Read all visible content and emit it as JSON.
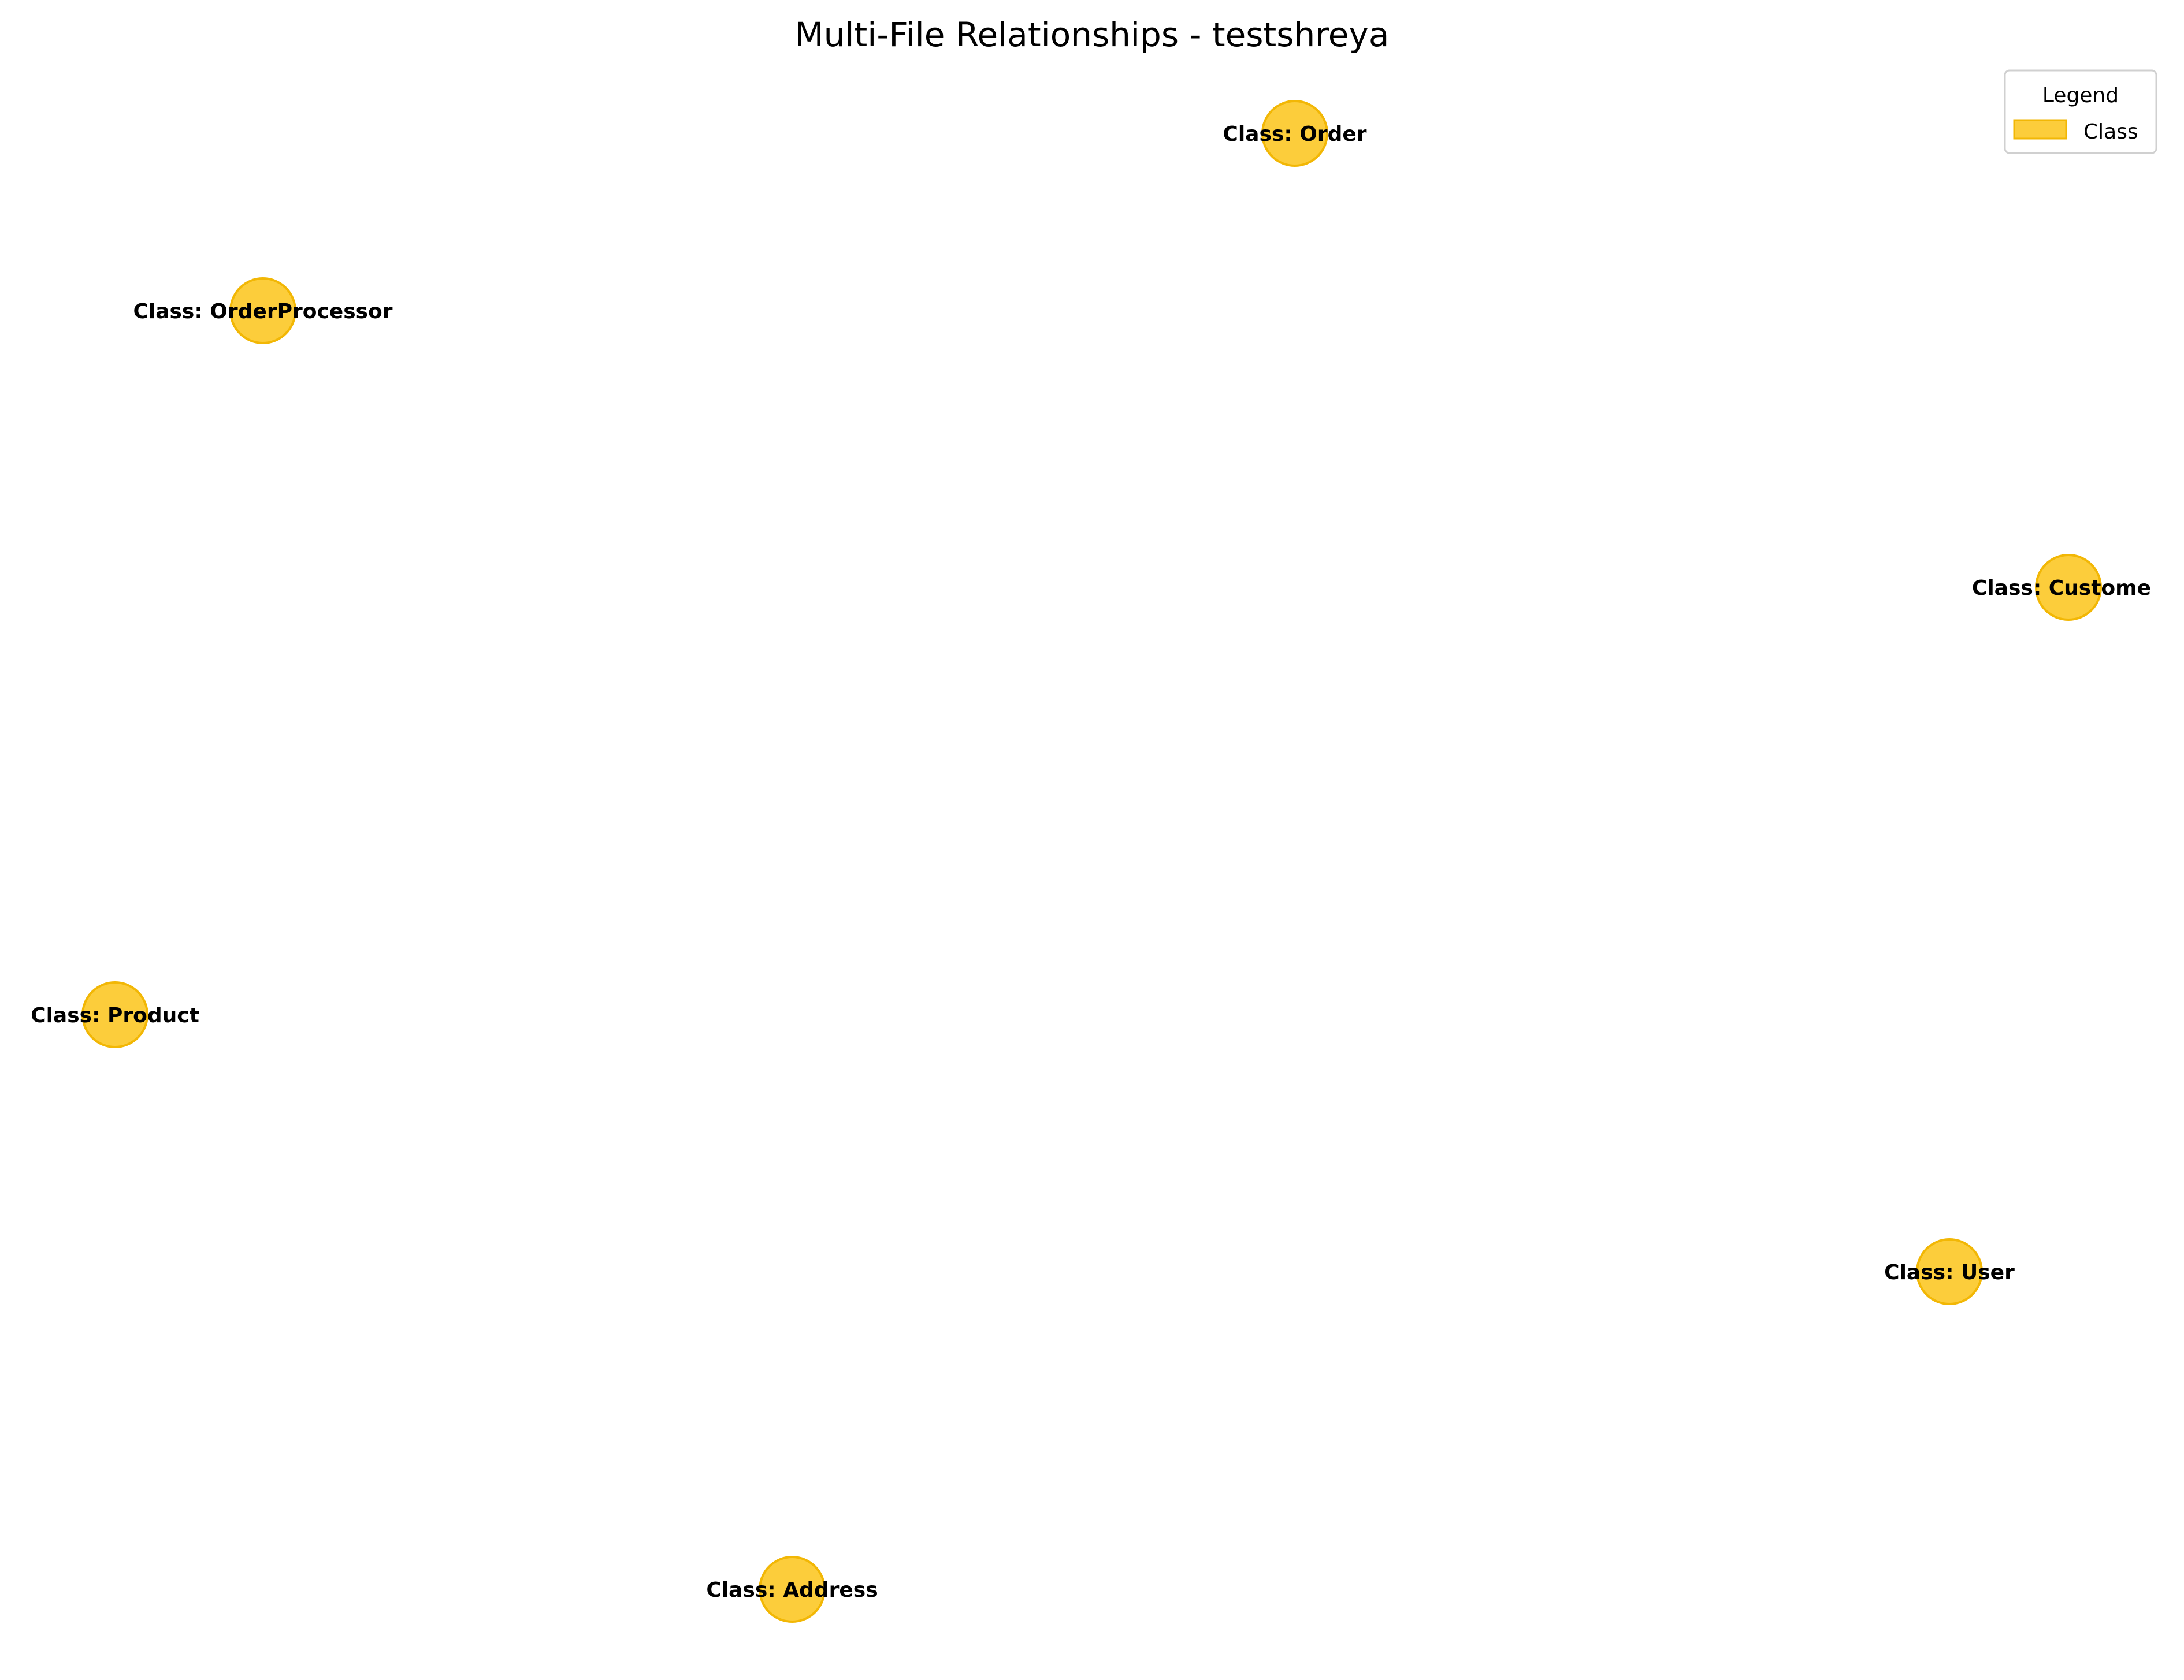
{
  "diagram": {
    "title": "Multi-File Relationships - testshreya",
    "node_color": "#fcc419",
    "node_edge_color": "#f2b705",
    "nodes": [
      {
        "id": "order",
        "label": "Class: Order",
        "type": "Class"
      },
      {
        "id": "orderprocessor",
        "label": "Class: OrderProcessor",
        "type": "Class"
      },
      {
        "id": "customer",
        "label": "Class: Custome",
        "type": "Class"
      },
      {
        "id": "product",
        "label": "Class: Product",
        "type": "Class"
      },
      {
        "id": "user",
        "label": "Class: User",
        "type": "Class"
      },
      {
        "id": "address",
        "label": "Class: Address",
        "type": "Class"
      }
    ],
    "edges": []
  },
  "legend": {
    "title": "Legend",
    "items": [
      {
        "label": "Class",
        "color": "#fcc419"
      }
    ]
  }
}
